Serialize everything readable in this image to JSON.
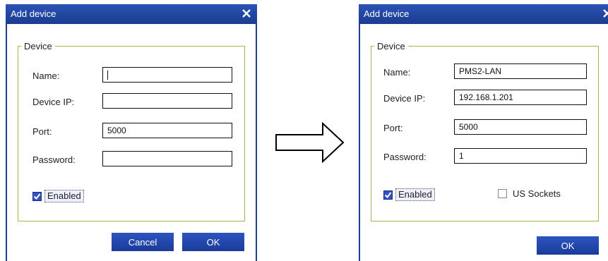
{
  "dialog_left": {
    "title": "Add device",
    "group_label": "Device",
    "fields": {
      "name_label": "Name:",
      "name_value": "",
      "ip_label": "Device IP:",
      "ip_value": "",
      "port_label": "Port:",
      "port_value": "5000",
      "password_label": "Password:",
      "password_value": ""
    },
    "enabled_label": "Enabled",
    "enabled_checked": true,
    "cancel_label": "Cancel",
    "ok_label": "OK"
  },
  "dialog_right": {
    "title": "Add device",
    "group_label": "Device",
    "fields": {
      "name_label": "Name:",
      "name_value": "PMS2-LAN",
      "ip_label": "Device IP:",
      "ip_value": "192.168.1.201",
      "port_label": "Port:",
      "port_value": "5000",
      "password_label": "Password:",
      "password_value": "1"
    },
    "enabled_label": "Enabled",
    "enabled_checked": true,
    "us_sockets_label": "US Sockets",
    "us_sockets_checked": false,
    "ok_label": "OK"
  },
  "icons": {
    "close": "close-icon",
    "check": "checkmark-icon",
    "arrow": "right-arrow-icon"
  },
  "colors": {
    "titlebar": "#1f3e93",
    "group_border": "#9dbb4a",
    "button": "#2148ad"
  }
}
